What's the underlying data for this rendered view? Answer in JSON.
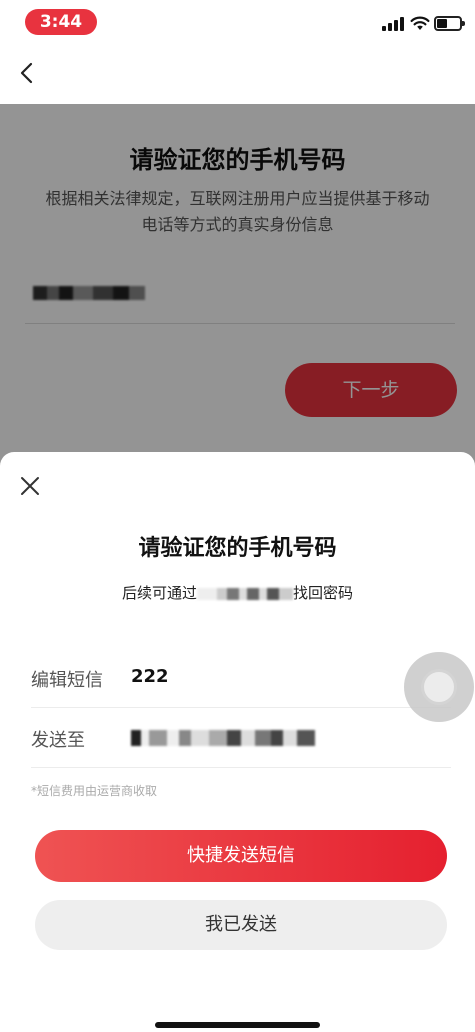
{
  "status_bar": {
    "time": "3:44",
    "time_pill_color": "#e8333f"
  },
  "nav": {
    "back_icon": "chevron-left-icon"
  },
  "background_page": {
    "title": "请验证您的手机号码",
    "description": "根据相关法律规定，互联网注册用户应当提供基于移动电话等方式的真实身份信息",
    "next_label": "下一步"
  },
  "sheet": {
    "close_icon": "close-icon",
    "title": "请验证您的手机号码",
    "subtitle_prefix": "后续可通过",
    "subtitle_suffix": "找回密码",
    "sms_label": "编辑短信",
    "sms_value": "222",
    "send_to_label": "发送至",
    "note": "*短信费用由运营商收取",
    "primary_label": "快捷发送短信",
    "secondary_label": "我已发送"
  },
  "colors": {
    "accent": "#e8333f",
    "secondary_bg": "#eeeeee"
  }
}
